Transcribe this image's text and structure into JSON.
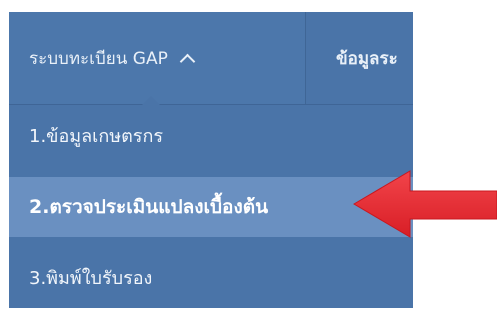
{
  "navbar": {
    "active_label": "ระบบทะเบียน GAP",
    "next_label": "ข้อมูลระ"
  },
  "dropdown": {
    "items": [
      {
        "label": "1.ข้อมูลเกษตรกร"
      },
      {
        "label": "2.ตรวจประเมินแปลงเบื้องต้น"
      },
      {
        "label": "3.พิมพ์ใบรับรอง"
      }
    ],
    "selected_index": 1
  },
  "colors": {
    "nav_bg": "#4a74a8",
    "highlight_bg": "#6a90c1",
    "arrow": "#e8252d"
  },
  "icons": {
    "caret": "chevron-up-icon",
    "annotation": "red-arrow-icon"
  }
}
